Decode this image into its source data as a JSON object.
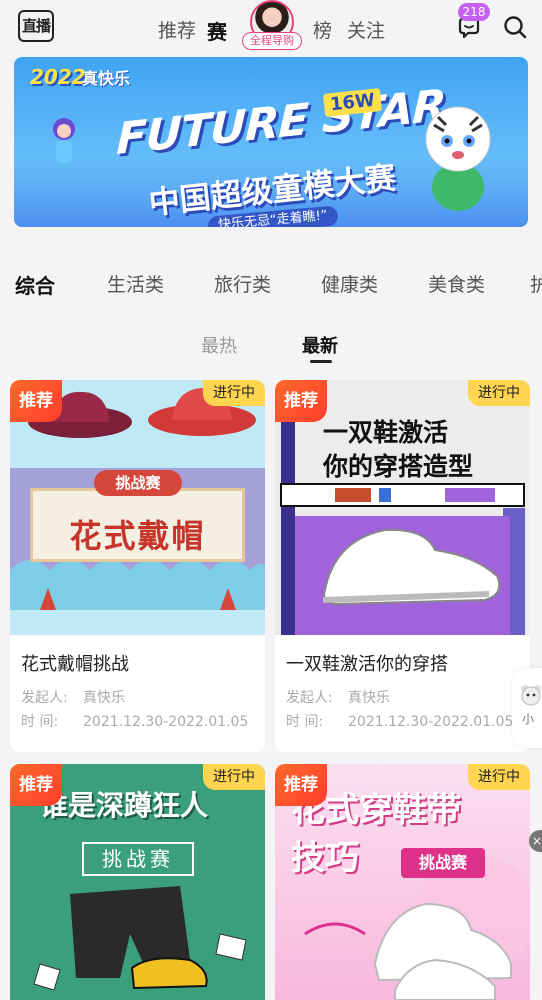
{
  "nav": {
    "logo": "直播",
    "tabs": [
      "推荐",
      "赛",
      "榜",
      "关注"
    ],
    "avatar_tag": "全程导购",
    "message_badge": "218"
  },
  "banner": {
    "year": "2022",
    "brand": "真快乐",
    "headline_en": "FUTURE STAR",
    "tag": "16W",
    "headline_cn": "中国超级童模大赛",
    "slogan": "快乐无忌“走着瞧!”"
  },
  "categories": [
    "综合",
    "生活类",
    "旅行类",
    "健康类",
    "美食类"
  ],
  "category_cut": "护",
  "sort_tabs": [
    "最热",
    "最新"
  ],
  "cards": [
    {
      "recommend_tag": "推荐",
      "status": "进行中",
      "cover_ribbon": "挑战赛",
      "cover_text": "花式戴帽",
      "title": "花式戴帽挑战",
      "initiator_label": "发起人:",
      "initiator": "真快乐",
      "time_label": "时  间:",
      "time": "2021.12.30-2022.01.05"
    },
    {
      "recommend_tag": "推荐",
      "status": "进行中",
      "cover_line1": "一双鞋激活",
      "cover_line2": "你的穿搭造型",
      "title": "一双鞋激活你的穿搭",
      "initiator_label": "发起人:",
      "initiator": "真快乐",
      "time_label": "时  间:",
      "time": "2021.12.30-2022.01.05"
    },
    {
      "recommend_tag": "推荐",
      "status": "进行中",
      "cover_line1": "谁是深蹲狂人",
      "cover_line2": "挑战赛"
    },
    {
      "recommend_tag": "推荐",
      "status": "进行中",
      "cover_line1": "花式穿鞋带",
      "cover_line2": "技巧",
      "cover_pill": "挑战赛"
    }
  ],
  "side_float_label": "小",
  "side_close": "×",
  "colors": {
    "accent_orange": "#ff4e2c",
    "status_yellow": "#ffd44f",
    "badge_purple": "#c560f0",
    "avatar_pink": "#e8457a"
  }
}
